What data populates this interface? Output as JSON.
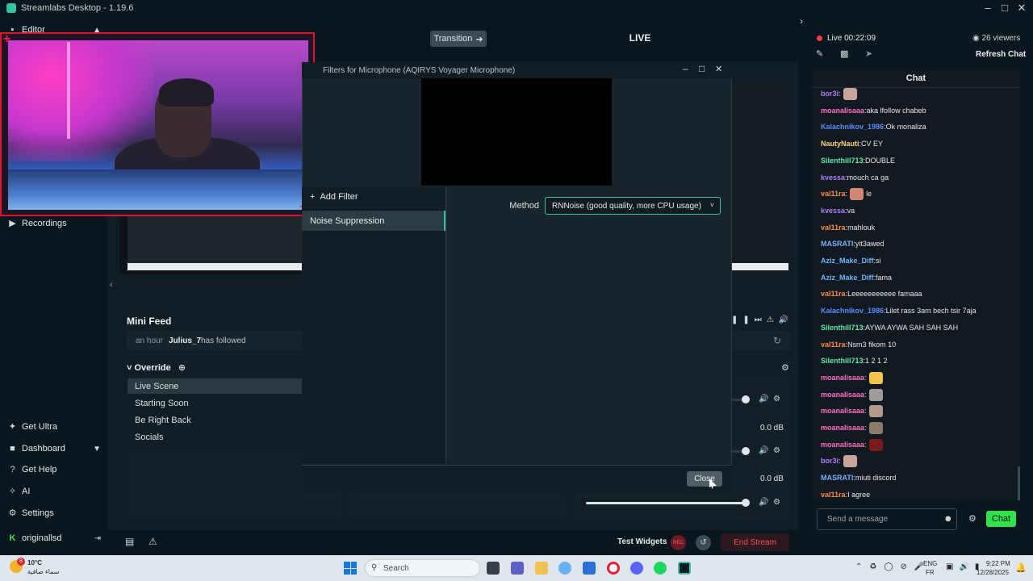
{
  "app": {
    "title": "Streamlabs Desktop - 1.19.6"
  },
  "leftnav": {
    "editor": "Editor",
    "recordings": "Recordings",
    "get_ultra": "Get Ultra",
    "dashboard": "Dashboard",
    "get_help": "Get Help",
    "ai": "AI",
    "settings": "Settings",
    "username": "originallsd"
  },
  "editor": {
    "transition_label": "Transition",
    "live_label": "LIVE",
    "minifeed_title": "Mini Feed",
    "feed_time": "an hour",
    "feed_user": "Julius_7",
    "feed_action": "has followed",
    "scenes_header": "Override",
    "scenes": [
      "Live Scene",
      "Starting Soon",
      "Be Right Back",
      "Socials"
    ],
    "mixer_db": [
      "0.0 dB",
      "0.0 dB"
    ],
    "test_widgets": "Test Widgets",
    "end_stream": "End Stream",
    "rec_label": "REC"
  },
  "dialog": {
    "title": "Filters for Microphone (AQIRYS Voyager Microphone)",
    "add_filter": "Add Filter",
    "filter_item": "Noise Suppression",
    "method_label": "Method",
    "method_value": "RNNoise (good quality, more CPU usage)",
    "close_label": "Close"
  },
  "chat": {
    "live_time": "Live 00:22:09",
    "viewers": "26 viewers",
    "refresh": "Refresh Chat",
    "header": "Chat",
    "input_placeholder": "Send a message",
    "send_label": "Chat",
    "messages": [
      {
        "user": "bor3i",
        "text": "",
        "color": "#b57bff",
        "emote": "#c9a49a"
      },
      {
        "user": "moanalisaaa",
        "text": "aka lfollow chabeb",
        "color": "#ff6ec7"
      },
      {
        "user": "Kalachnikov_1986",
        "text": "Ok monaliza",
        "color": "#5a8cff"
      },
      {
        "user": "NautyNauti",
        "text": "CV EY",
        "color": "#ffd27a"
      },
      {
        "user": "Silenthill713",
        "text": "DOUBLE",
        "color": "#5fe8a8"
      },
      {
        "user": "kvessa",
        "text": "mouch ca ga",
        "color": "#b57bff"
      },
      {
        "user": "val11ra",
        "text": "le",
        "color": "#ff8a4a",
        "emote": "#d08670"
      },
      {
        "user": "kvessa",
        "text": "va",
        "color": "#b57bff"
      },
      {
        "user": "val11ra",
        "text": "mahlouk",
        "color": "#ff8a4a"
      },
      {
        "user": "MASRATI",
        "text": "yit3awed",
        "color": "#7bb0ff"
      },
      {
        "user": "Aziz_Make_Diff",
        "text": "si",
        "color": "#6fb6ff"
      },
      {
        "user": "Aziz_Make_Diff",
        "text": "fama",
        "color": "#6fb6ff"
      },
      {
        "user": "val11ra",
        "text": "Leeeeeeeeeee famaaa",
        "color": "#ff8a4a"
      },
      {
        "user": "Kalachnikov_1986",
        "text": "Lilet rass 3am bech tsir 7aja",
        "color": "#5a8cff"
      },
      {
        "user": "Silenthill713",
        "text": "AYWA AYWA SAH SAH SAH",
        "color": "#5fe8a8"
      },
      {
        "user": "val11ra",
        "text": "Nsm3 fikom 10",
        "color": "#ff8a4a"
      },
      {
        "user": "Silenthill713",
        "text": "1 2 1 2",
        "color": "#5fe8a8"
      },
      {
        "user": "moanalisaaa",
        "text": "",
        "color": "#ff6ec7",
        "emote": "#f2c44a"
      },
      {
        "user": "moanalisaaa",
        "text": "",
        "color": "#ff6ec7",
        "emote": "#a09a98"
      },
      {
        "user": "moanalisaaa",
        "text": "",
        "color": "#ff6ec7",
        "emote": "#b29a8a"
      },
      {
        "user": "moanalisaaa",
        "text": "",
        "color": "#ff6ec7",
        "emote": "#8a7a6a"
      },
      {
        "user": "moanalisaaa",
        "text": "",
        "color": "#ff6ec7",
        "emote": "#7a1a1a"
      },
      {
        "user": "bor3i",
        "text": "",
        "color": "#b57bff",
        "emote": "#c9a49a"
      },
      {
        "user": "MASRATI",
        "text": "miuti discord",
        "color": "#7bb0ff"
      },
      {
        "user": "val11ra",
        "text": "I agree",
        "color": "#ff8a4a"
      }
    ]
  },
  "taskbar": {
    "weather_temp": "10°C",
    "weather_desc": "سماء صافية",
    "weather_badge": "8",
    "search_placeholder": "Search",
    "lang1": "ENG",
    "lang2": "FR",
    "time": "9:22 PM",
    "date": "12/28/2025"
  }
}
